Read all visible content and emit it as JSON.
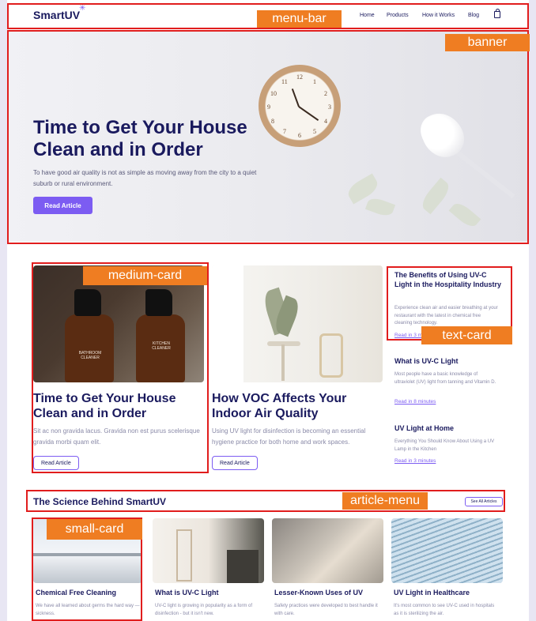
{
  "brand": {
    "name": "SmartUV",
    "accent": "#7c5cf2",
    "navy": "#1a1a5e"
  },
  "nav": {
    "links": [
      "Home",
      "Products",
      "How it Works",
      "Blog"
    ],
    "cart_icon": "shopping-bag-icon"
  },
  "hero": {
    "title": "Time to Get Your House Clean and in Order",
    "description": "To have good air quality is not as simple as moving away from the city to a quiet suburb or rural environment.",
    "button": "Read Article",
    "clock_numbers": [
      "12",
      "1",
      "2",
      "3",
      "4",
      "5",
      "6",
      "7",
      "8",
      "9",
      "10",
      "11"
    ]
  },
  "featured": [
    {
      "title": "Time to Get Your House Clean and in Order",
      "description": "Sit ac non gravida lacus. Gravida non est purus scelerisque gravida morbi quam elit.",
      "button": "Read Article",
      "bottle_label": "BATHROOM CLEANER",
      "bottle_label_2": "KITCHEN CLEANER"
    },
    {
      "title": "How VOC Affects Your Indoor Air Quality",
      "description": "Using UV light for disinfection is becoming an essential hygiene practice for both home and work spaces.",
      "button": "Read Article"
    }
  ],
  "text_cards": [
    {
      "title": "The Benefits of Using UV-C Light in the Hospitality Industry",
      "description": "Experience clean air and easier breathing at your restaurant with the latest in chemical free cleaning technology.",
      "link": "Read in 3 minutes"
    },
    {
      "title": "What is UV-C Light",
      "description": "Most people have a basic knowledge of ultraviolet (UV) light from tanning and Vitamin D.",
      "link": "Read in 8 minutes"
    },
    {
      "title": "UV Light at Home",
      "description": "Everything You Should Know About Using a UV Lamp in the Kitchen",
      "link": "Read in 3 minutes"
    }
  ],
  "articles": {
    "title": "The Science Behind SmartUV",
    "see_all": "See All Articles",
    "items": [
      {
        "title": "Chemical Free Cleaning",
        "description": "We have all learned about germs the hard way — sickness."
      },
      {
        "title": "What is UV-C Light",
        "description": "UV-C light is growing in popularity as a form of disinfection - but it isn't new."
      },
      {
        "title": "Lesser-Known Uses of UV",
        "description": "Safety practices were developed to best handle it with care."
      },
      {
        "title": "UV Light in Healthcare",
        "description": "It's most common to see UV-C used in hospitals as it is sterilizing the air."
      }
    ]
  },
  "annotations": {
    "menu_bar": "menu-bar",
    "banner": "banner",
    "medium_card": "medium-card",
    "text_card": "text-card",
    "article_menu": "article-menu",
    "small_card": "small-card"
  }
}
